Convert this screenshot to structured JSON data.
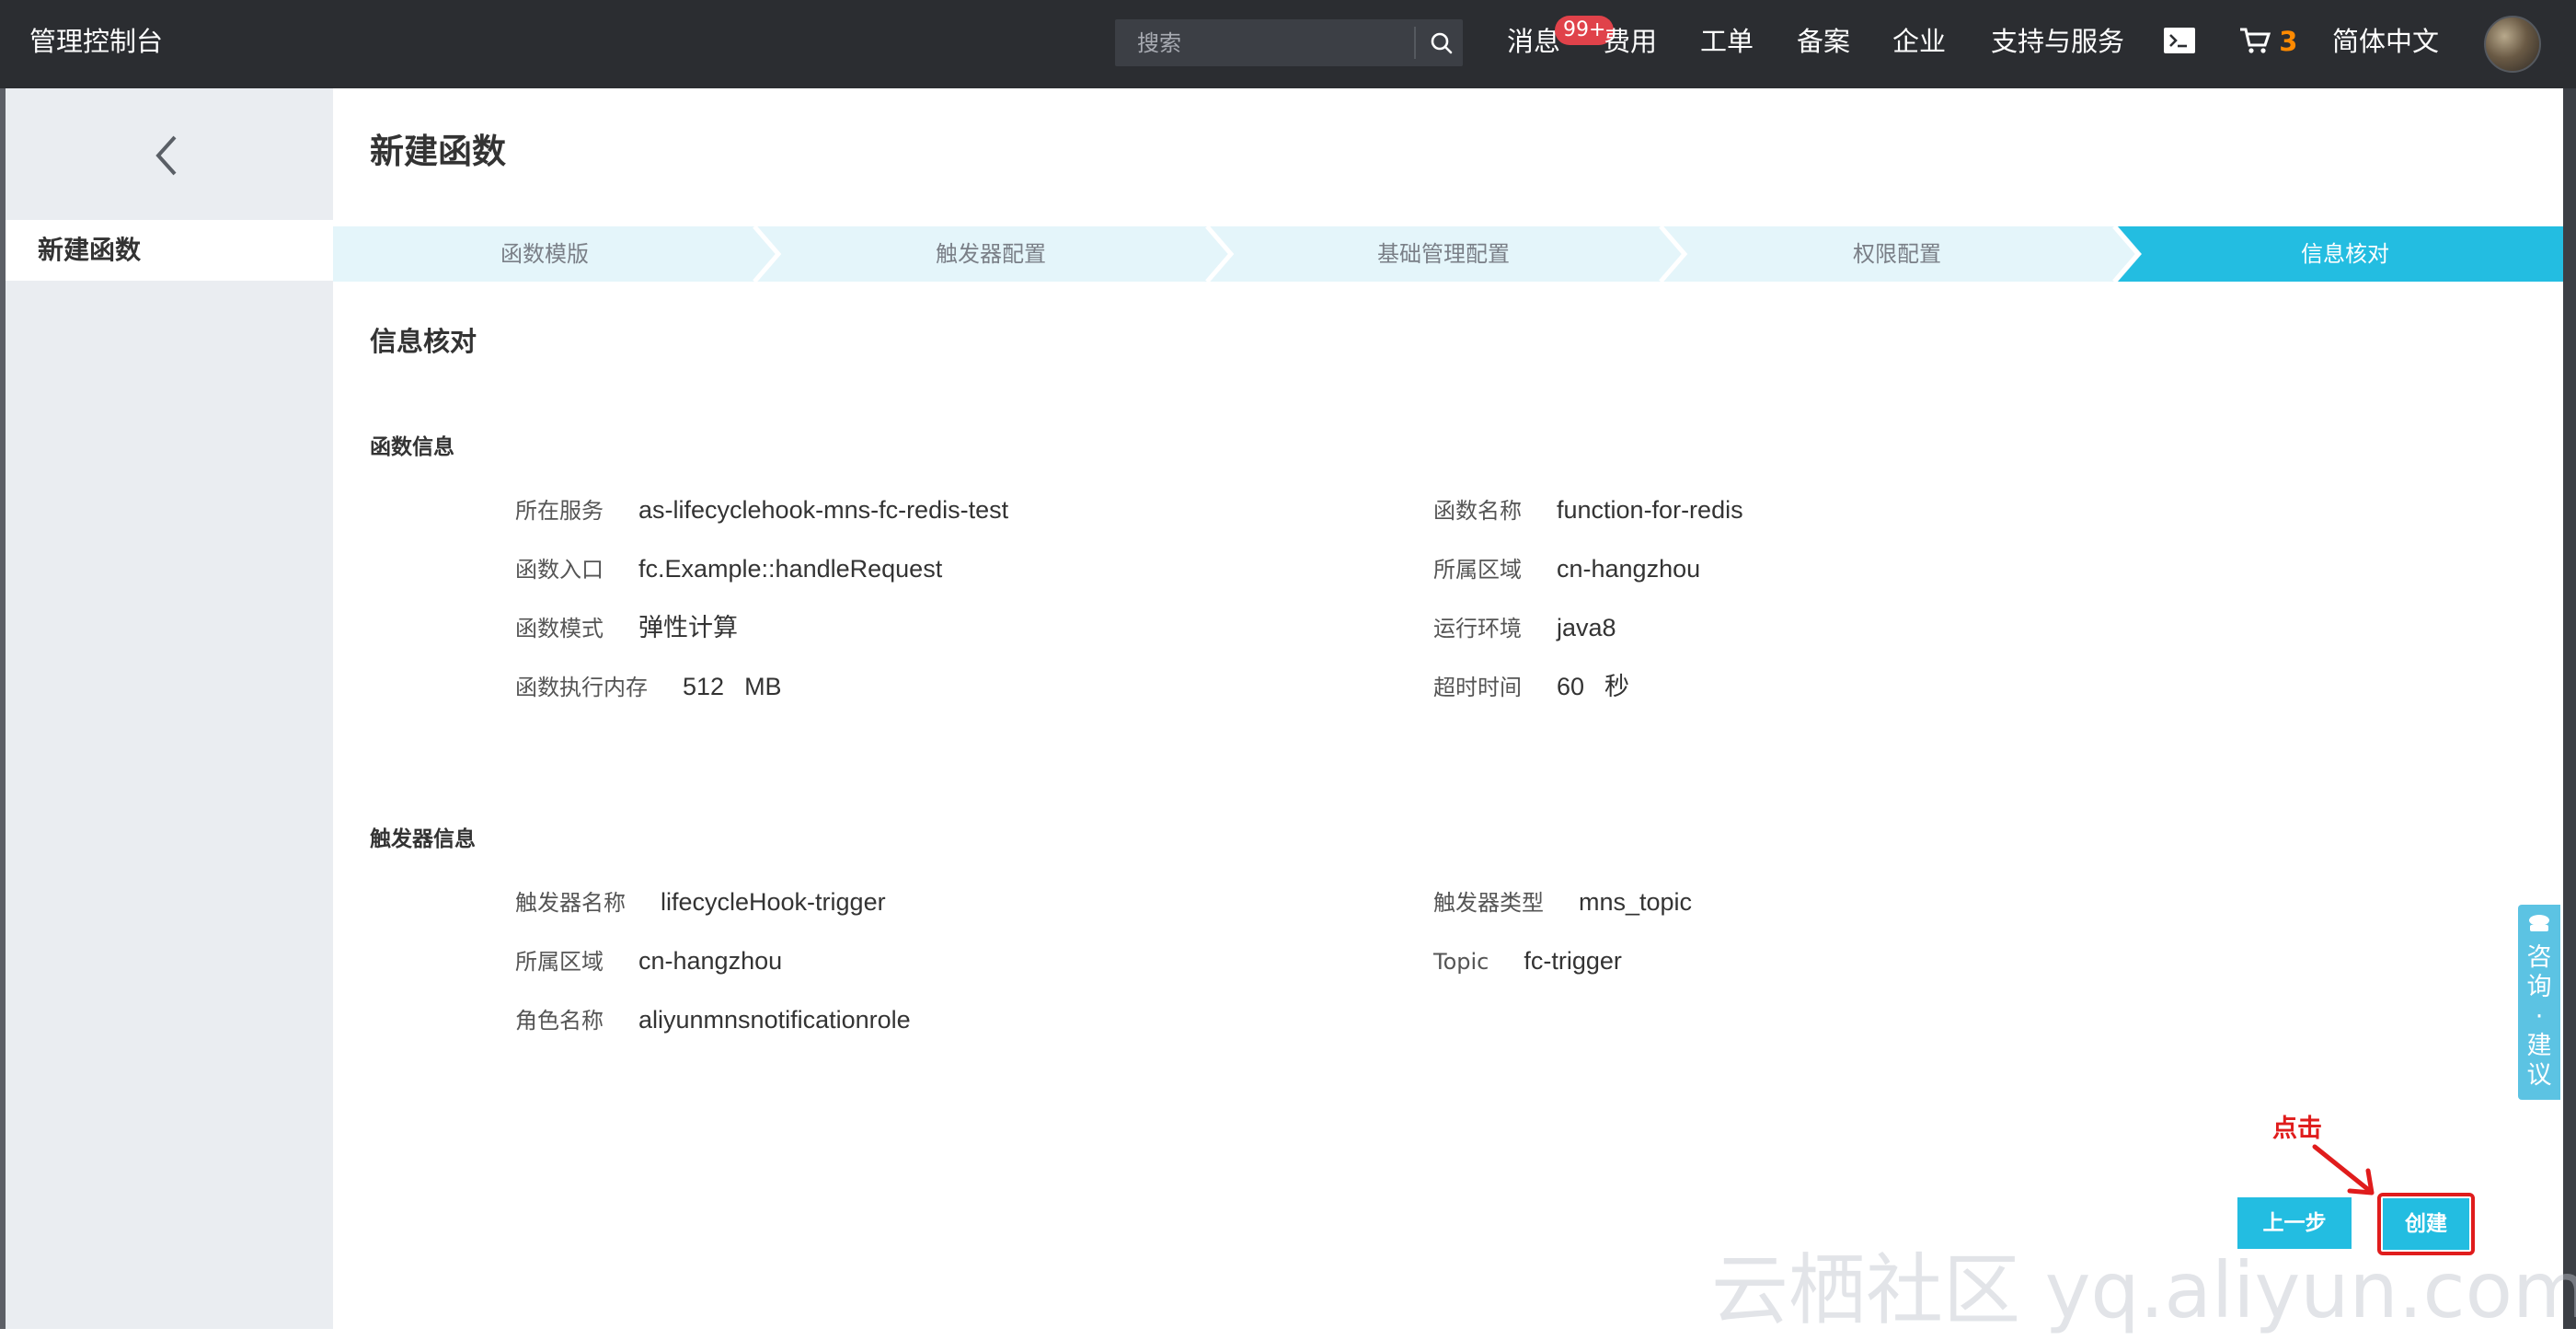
{
  "topbar": {
    "brand": "管理控制台",
    "search_placeholder": "搜索",
    "nav": {
      "messages": "消息",
      "messages_badge": "99+",
      "billing": "费用",
      "tickets": "工单",
      "filing": "备案",
      "enterprise": "企业",
      "support": "支持与服务",
      "cart_count": "3",
      "language": "简体中文"
    }
  },
  "sidebar": {
    "active_item": "新建函数"
  },
  "page": {
    "title": "新建函数",
    "steps": [
      {
        "label": "函数模版",
        "active": false
      },
      {
        "label": "触发器配置",
        "active": false
      },
      {
        "label": "基础管理配置",
        "active": false
      },
      {
        "label": "权限配置",
        "active": false
      },
      {
        "label": "信息核对",
        "active": true
      }
    ],
    "section_title": "信息核对",
    "function_info": {
      "title": "函数信息",
      "service_label": "所在服务",
      "service_value": "as-lifecyclehook-mns-fc-redis-test",
      "name_label": "函数名称",
      "name_value": "function-for-redis",
      "entry_label": "函数入口",
      "entry_value": "fc.Example::handleRequest",
      "region_label": "所属区域",
      "region_value": "cn-hangzhou",
      "mode_label": "函数模式",
      "mode_value": "弹性计算",
      "runtime_label": "运行环境",
      "runtime_value": "java8",
      "memory_label": "函数执行内存",
      "memory_value": "512",
      "memory_unit": "MB",
      "timeout_label": "超时时间",
      "timeout_value": "60",
      "timeout_unit": "秒"
    },
    "trigger_info": {
      "title": "触发器信息",
      "name_label": "触发器名称",
      "name_value": "lifecycleHook-trigger",
      "type_label": "触发器类型",
      "type_value": "mns_topic",
      "region_label": "所属区域",
      "region_value": "cn-hangzhou",
      "topic_label": "Topic",
      "topic_value": "fc-trigger",
      "role_label": "角色名称",
      "role_value": "aliyunmnsnotificationrole"
    },
    "buttons": {
      "prev": "上一步",
      "create": "创建"
    },
    "annotation": "点击",
    "feedback": [
      "咨",
      "询",
      "·",
      "建",
      "议"
    ],
    "watermark": "云栖社区 yq.aliyun.com"
  },
  "colors": {
    "topbar": "#2b2d31",
    "accent": "#23bde1",
    "step_bg": "#e4f5fa",
    "annotation": "#e01c1c",
    "badge": "#e0424a"
  }
}
